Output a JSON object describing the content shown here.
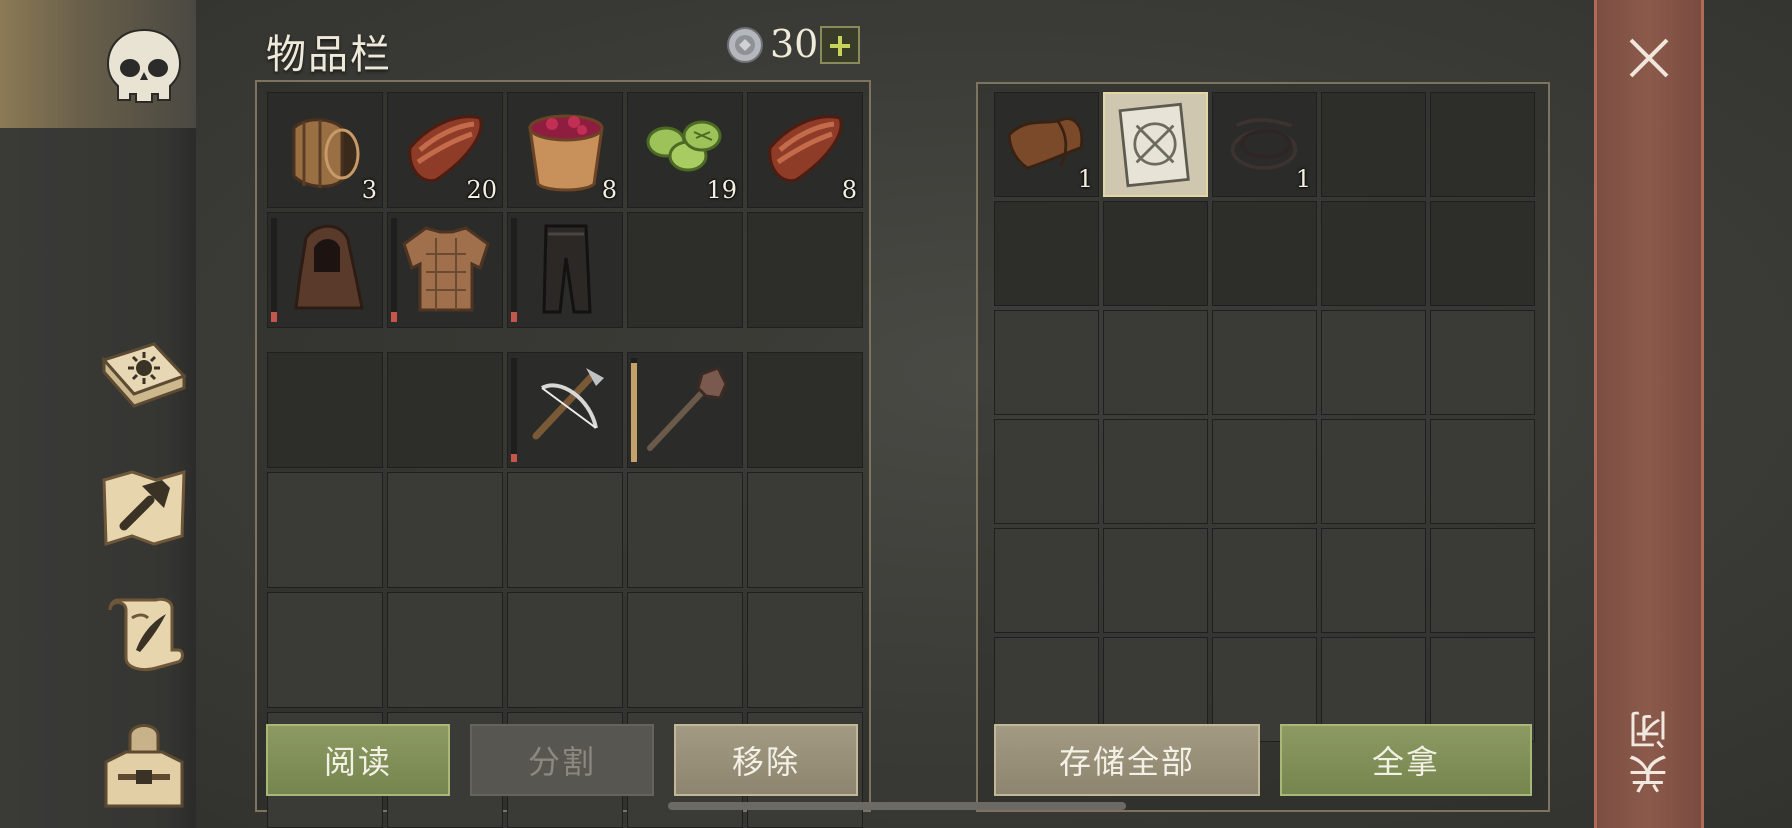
{
  "header": {
    "title": "物品栏",
    "currency": {
      "icon": "silver-coin-icon",
      "amount": "30"
    }
  },
  "tabs": [
    {
      "name": "character",
      "icon": "skull-icon",
      "active": true
    },
    {
      "name": "skills",
      "icon": "sun-book-icon",
      "active": false
    },
    {
      "name": "crafting",
      "icon": "hammer-icon",
      "active": false
    },
    {
      "name": "quests",
      "icon": "scroll-quill-icon",
      "active": false
    },
    {
      "name": "equipment",
      "icon": "hooded-figure-icon",
      "active": false
    }
  ],
  "inventory": {
    "bag": [
      {
        "item": "barrel",
        "qty": "3"
      },
      {
        "item": "raw-meat",
        "qty": "20"
      },
      {
        "item": "berry-bowl",
        "qty": "8"
      },
      {
        "item": "cactus-slices",
        "qty": "19"
      },
      {
        "item": "raw-meat",
        "qty": "8"
      },
      {
        "item": "leather-hood",
        "durability": 0.1
      },
      {
        "item": "leather-shirt",
        "durability": 0.1
      },
      {
        "item": "leather-pants",
        "durability": 0.1
      },
      {
        "item": ""
      },
      {
        "item": ""
      }
    ],
    "hotbar_top": [
      {
        "item": ""
      },
      {
        "item": ""
      },
      {
        "item": "crossbow",
        "durability": 0.08
      },
      {
        "item": "mace",
        "durability": 0.95
      },
      {
        "item": ""
      }
    ]
  },
  "container": {
    "items": [
      {
        "item": "leather-piece",
        "qty": "1"
      },
      {
        "item": "blueprint",
        "selected": true
      },
      {
        "item": "rope",
        "qty": "1"
      }
    ]
  },
  "buttons": {
    "read": "阅读",
    "split": "分割",
    "remove": "移除",
    "store_all": "存储全部",
    "take_all": "全拿"
  },
  "close": {
    "label": "关闭"
  }
}
